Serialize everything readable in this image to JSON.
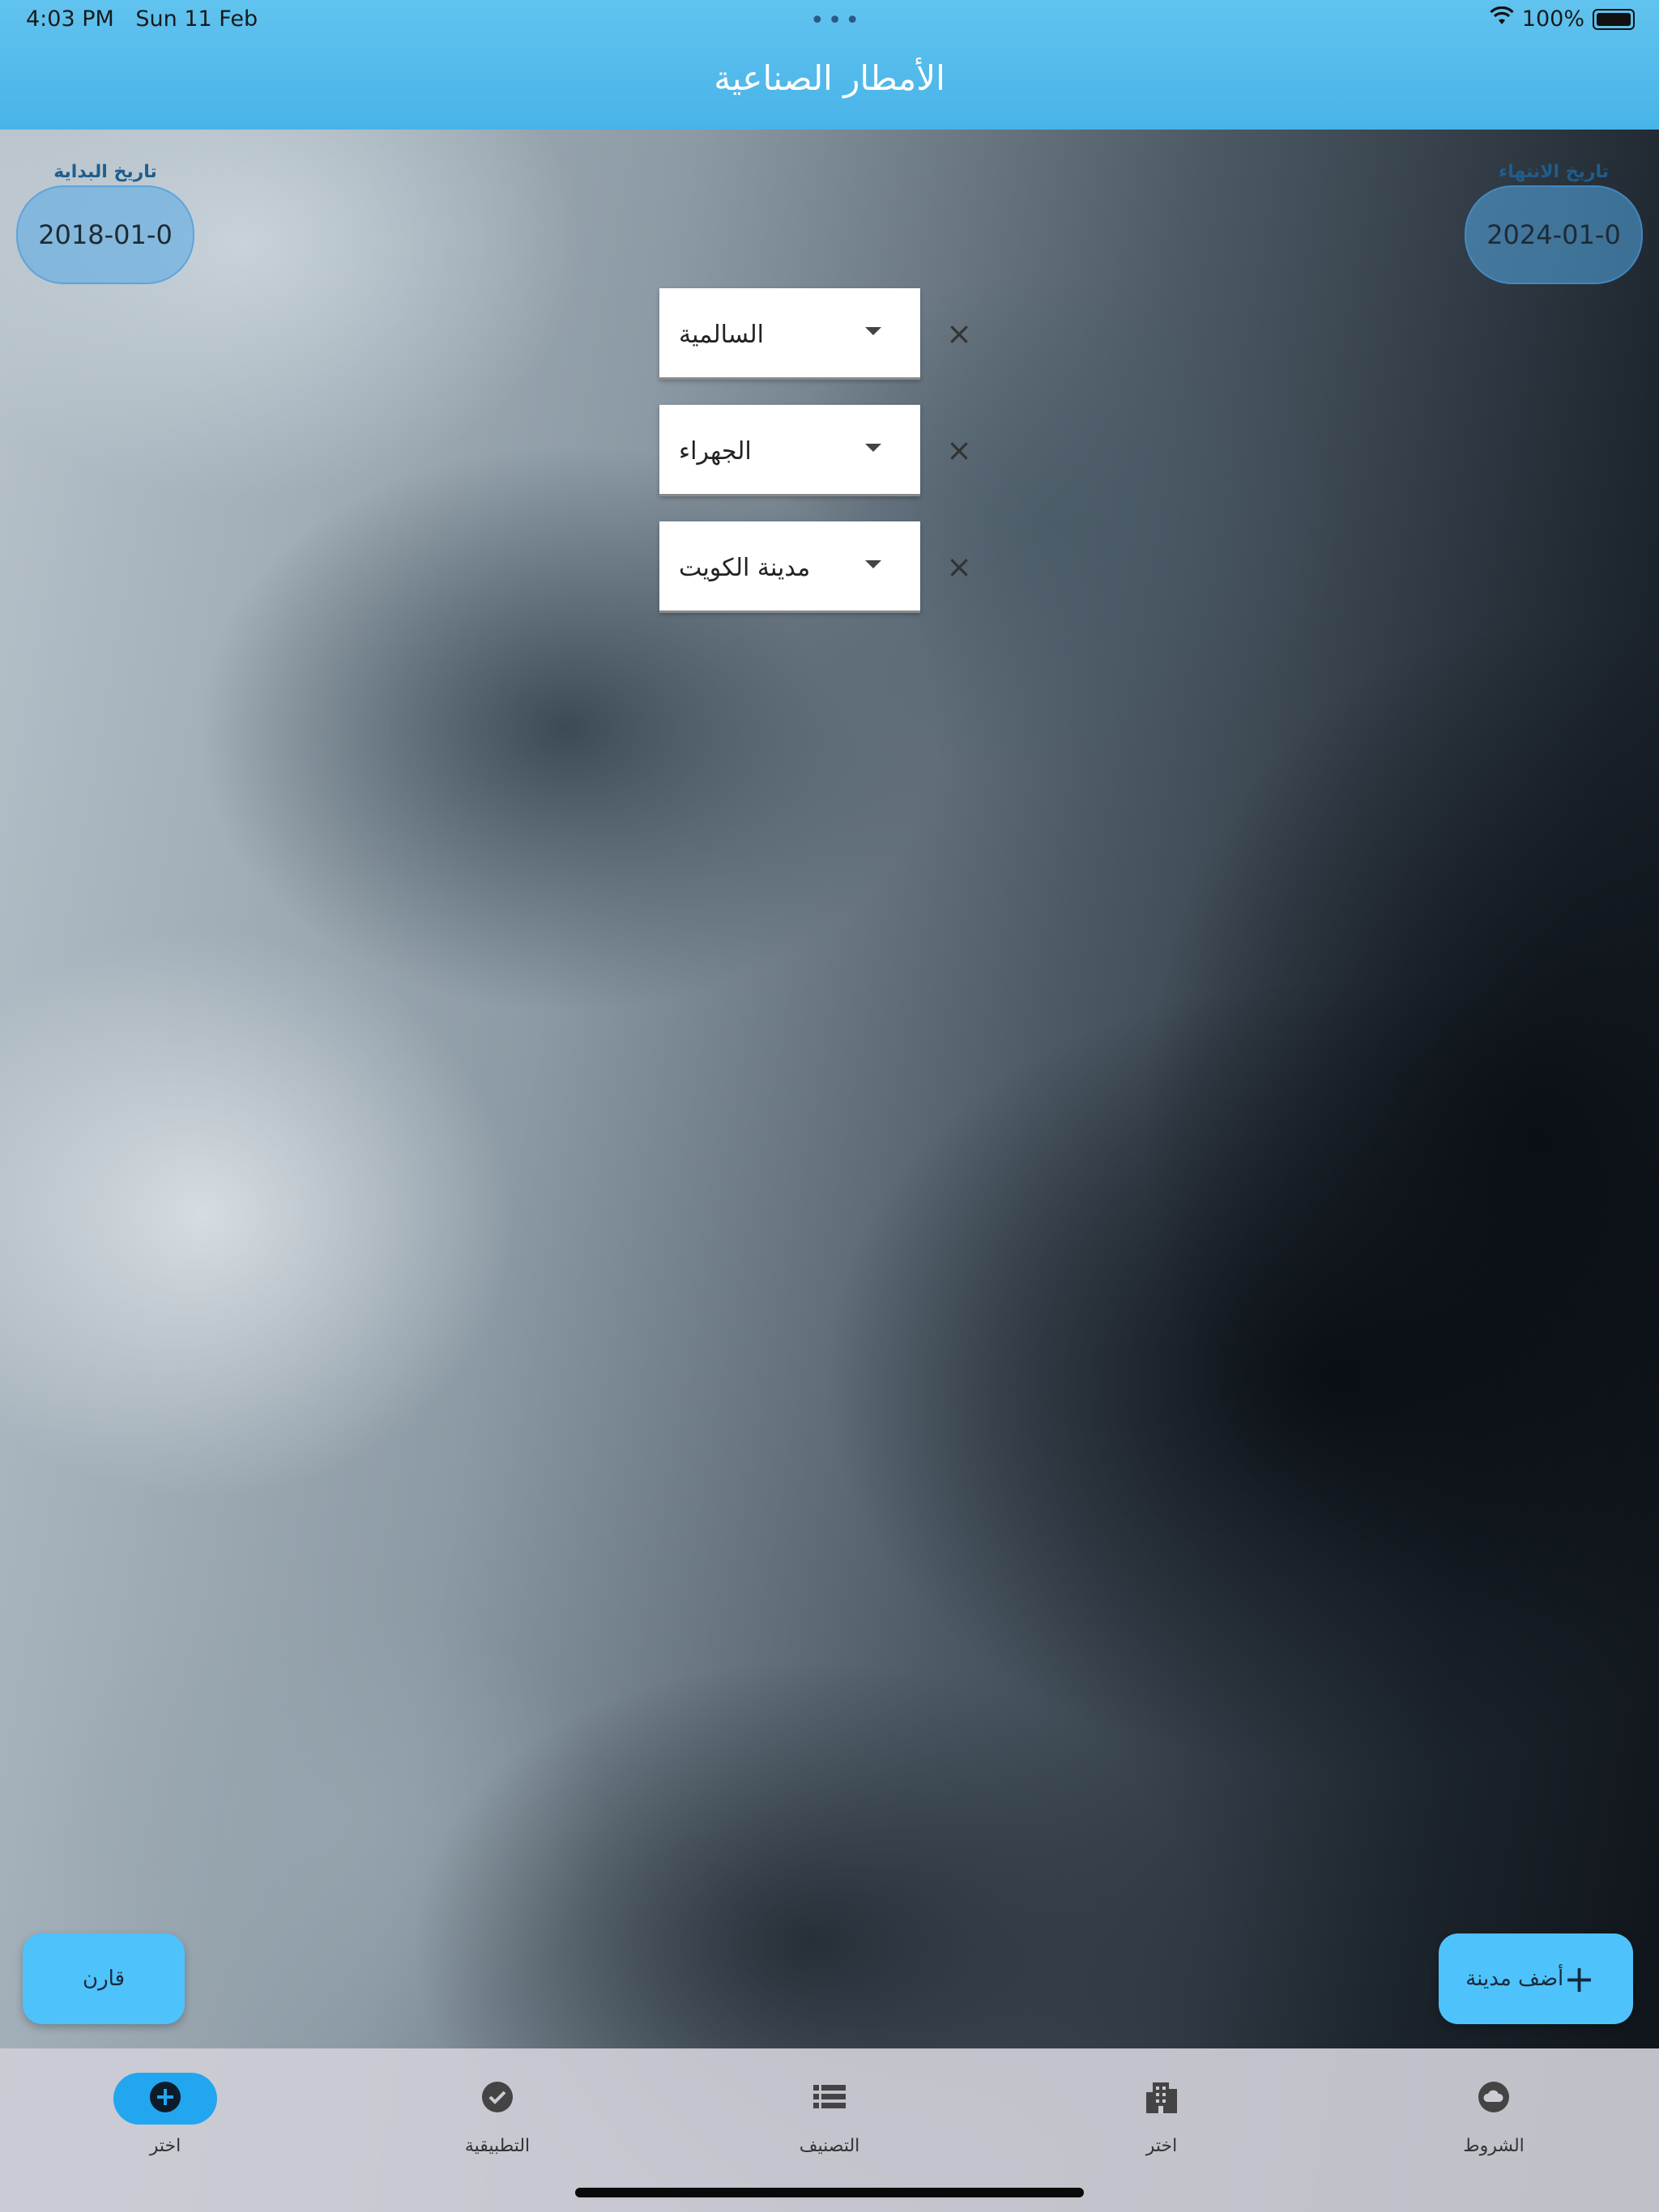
{
  "status_bar": {
    "time": "4:03 PM",
    "date": "Sun 11 Feb",
    "dots": "•••",
    "battery_text": "100%"
  },
  "header": {
    "title": "الأمطار الصناعية"
  },
  "start_date": {
    "label": "تاريخ البداية",
    "value": "2018-01-0"
  },
  "end_date": {
    "label": "تاريخ الانتهاء",
    "value": "2024-01-0"
  },
  "cities": [
    {
      "value": "السالمية",
      "remove_icon": "×"
    },
    {
      "value": "الجهراء",
      "remove_icon": "×"
    },
    {
      "value": "مدينة الكويت",
      "remove_icon": "×"
    }
  ],
  "actions": {
    "compare_label": "قارن",
    "add_city_label": "أضف مدينة",
    "add_icon": "+"
  },
  "bottom_nav": [
    {
      "label": "اختر",
      "icon": "add-circle-icon",
      "active": true
    },
    {
      "label": "التطبيقية",
      "icon": "check-circle-icon",
      "active": false
    },
    {
      "label": "التصنيف",
      "icon": "list-icon",
      "active": false
    },
    {
      "label": "اختر",
      "icon": "building-icon",
      "active": false
    },
    {
      "label": "الشروط",
      "icon": "cloud-icon",
      "active": false
    }
  ],
  "colors": {
    "header": "#48b4e8",
    "accent": "#4ec2fb",
    "active_nav": "#22a6ef"
  }
}
